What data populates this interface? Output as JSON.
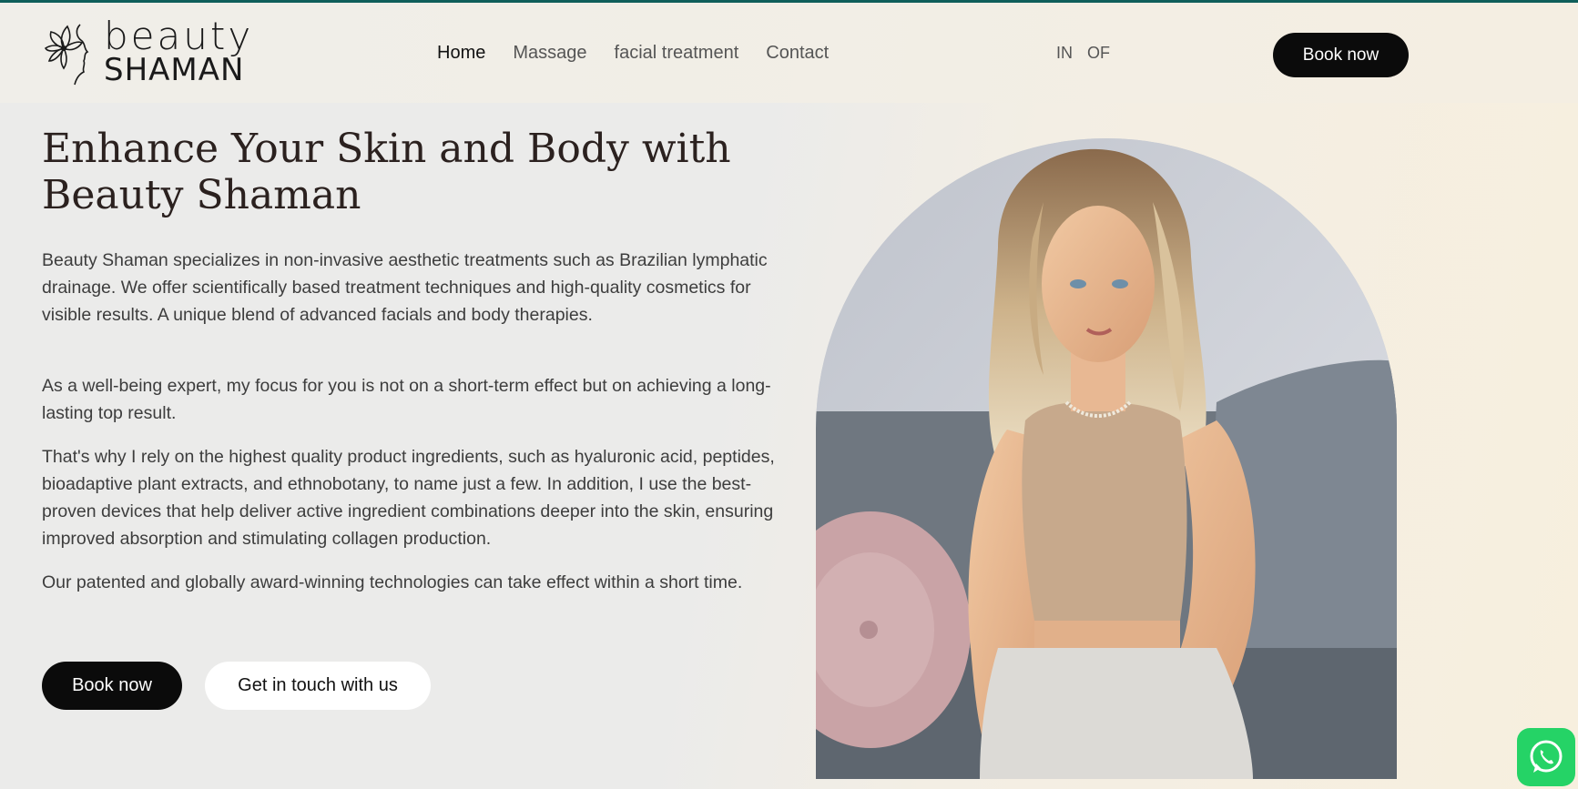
{
  "header": {
    "logo": {
      "line1": "beauty",
      "line2": "SHAMAN"
    },
    "nav": [
      {
        "label": "Home"
      },
      {
        "label": "Massage"
      },
      {
        "label": "facial treatment"
      },
      {
        "label": "Contact"
      }
    ],
    "languages": [
      "IN",
      "OF"
    ],
    "book_label": "Book now"
  },
  "hero": {
    "title": "Enhance Your Skin and Body with Beauty Shaman",
    "paragraphs": [
      "Beauty Shaman specializes in non-invasive aesthetic treatments such as Brazilian lymphatic drainage. We offer scientifically based treatment techniques and high-quality cosmetics for visible results. A unique blend of advanced facials and body therapies.",
      "As a well-being expert, my focus for you is not on a short-term effect but on achieving a long-lasting top result.",
      "That's why I rely on the highest quality product ingredients, such as hyaluronic acid, peptides, bioadaptive plant extracts, and ethnobotany, to name just a few. In addition, I use the best-proven devices that help deliver active ingredient combinations deeper into the skin, ensuring improved absorption and stimulating collagen production.",
      "Our patented and globally award-winning technologies can take effect within a short time."
    ],
    "primary_cta": "Book now",
    "secondary_cta": "Get in touch with us"
  },
  "colors": {
    "accent_line": "#0f5e5a",
    "button_dark": "#0b0b0b",
    "whatsapp": "#25d366"
  },
  "icons": {
    "logo": "lotus-face-logo",
    "chat": "whatsapp-icon"
  }
}
